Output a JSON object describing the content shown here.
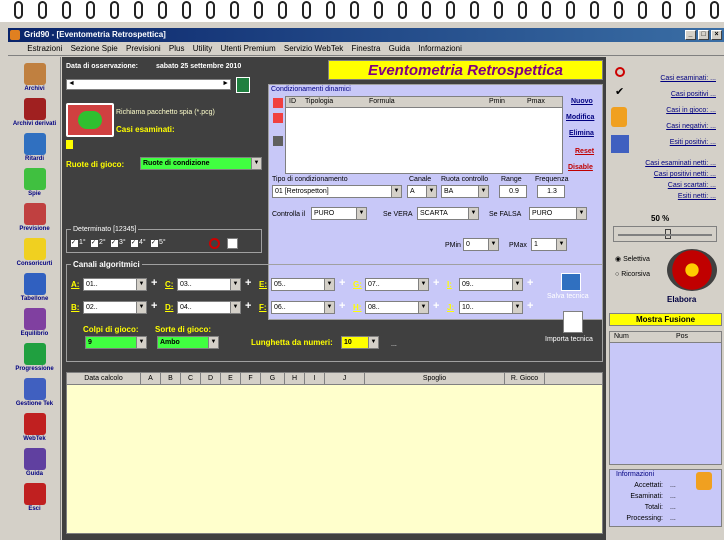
{
  "window": {
    "title": "Grid90 - [Eventometria Retrospettica]",
    "min": "_",
    "restore": "□",
    "close": "×"
  },
  "menu": [
    "Estrazioni",
    "Sezione Spie",
    "Previsioni",
    "Plus",
    "Utility",
    "Utenti Premium",
    "Servizio WebTek",
    "Finestra",
    "Guida",
    "Informazioni"
  ],
  "sidebar": [
    {
      "label": "Archivi",
      "icon": "pencil-icon",
      "color": "#c08040"
    },
    {
      "label": "Archivi derivati",
      "icon": "notebook-icon",
      "color": "#a02020"
    },
    {
      "label": "Ritardi",
      "icon": "clock-icon",
      "color": "#3070c0"
    },
    {
      "label": "Spie",
      "icon": "lens-icon",
      "color": "#40c040"
    },
    {
      "label": "Previsione",
      "icon": "clipboard-icon",
      "color": "#c04040"
    },
    {
      "label": "Consoricurti",
      "icon": "bulb-icon",
      "color": "#f0d020"
    },
    {
      "label": "Tabellone",
      "icon": "table-icon",
      "color": "#3060c0"
    },
    {
      "label": "Equilibrio",
      "icon": "scale-icon",
      "color": "#8040a0"
    },
    {
      "label": "Progressione",
      "icon": "dollar-icon",
      "color": "#20a040"
    },
    {
      "label": "Gestione Tek",
      "icon": "tools-icon",
      "color": "#4060c0"
    },
    {
      "label": "WebTek",
      "icon": "webtek-icon",
      "color": "#c02020"
    },
    {
      "label": "Guida",
      "icon": "book-icon",
      "color": "#6040a0"
    },
    {
      "label": "Esci",
      "icon": "exit-icon",
      "color": "#c02020"
    }
  ],
  "header": {
    "date_label": "Data di osservazione:",
    "date_value": "sabato 25 settembre 2010",
    "page_title": "Eventometria Retrospettica"
  },
  "packet": {
    "load_label": "Richiama pacchetto spia (*.pcg)",
    "cases_label": "Casi esaminati:"
  },
  "wheels": {
    "label": "Ruote di gioco:",
    "value": "Ruote di condizione"
  },
  "determinato": {
    "title": "Determinato [12345]",
    "items": [
      "1°",
      "2°",
      "3°",
      "4°",
      "5°"
    ]
  },
  "conditions": {
    "title": "Condizionamenti dinamici",
    "columns": [
      "ID",
      "Tipologia",
      "Formula",
      "Pmin",
      "Pmax"
    ],
    "buttons": {
      "new": "Nuovo",
      "edit": "Modifica",
      "delete": "Elimina",
      "reset": "Reset",
      "disable": "Disable"
    }
  },
  "cond_form": {
    "type_label": "Tipo di condizionamento",
    "type_value": "01 [Retrospetton]",
    "channel_label": "Canale",
    "channel_value": "A",
    "wheel_label": "Ruota controllo",
    "wheel_value": "BA",
    "range_label": "Range",
    "range_value": "0.9",
    "freq_label": "Frequenza",
    "freq_value": "1.3",
    "check_label": "Controlla il",
    "check_value": "PURO",
    "true_label": "Se VERA",
    "true_value": "SCARTA",
    "false_label": "Se FALSA",
    "false_value": "PURO",
    "pmin_label": "PMin",
    "pmin_value": "0",
    "pmax_label": "PMax",
    "pmax_value": "1"
  },
  "channels": {
    "title": "Canali algoritmici",
    "rows": [
      [
        {
          "l": "A:",
          "v": "01.."
        },
        {
          "l": "C:",
          "v": "03.."
        },
        {
          "l": "E:",
          "v": "05.."
        },
        {
          "l": "G:",
          "v": "07.."
        },
        {
          "l": "I:",
          "v": "09.."
        }
      ],
      [
        {
          "l": "B:",
          "v": "02.."
        },
        {
          "l": "D:",
          "v": "04.."
        },
        {
          "l": "F:",
          "v": "06.."
        },
        {
          "l": "H:",
          "v": "08.."
        },
        {
          "l": "J:",
          "v": "10.."
        }
      ]
    ],
    "save": "Salva tecnica",
    "import": "Importa tecnica",
    "shots_label": "Colpi di gioco:",
    "shots_value": "9",
    "sorts_label": "Sorte di gioco:",
    "sorts_value": "Ambo",
    "length_label": "Lunghetta da numeri:",
    "length_value": "10",
    "ellipsis": "..."
  },
  "table": {
    "columns": [
      "Data calcolo",
      "A",
      "B",
      "C",
      "D",
      "E",
      "F",
      "G",
      "H",
      "I",
      "J",
      "Spoglio",
      "R. Gioco"
    ]
  },
  "right": {
    "links_top": [
      "Casi esaminati: ...",
      "Casi positivi ...",
      "Casi in gioco: ...",
      "Casi negativi: ...",
      "Esiti positivi: ..."
    ],
    "links_bottom": [
      "Casi esaminati netti: ...",
      "Casi positivi netti: ...",
      "Casi scartati: ...",
      "Esiti netti: ..."
    ],
    "percent": "50 %",
    "radio1": "Selettiva",
    "radio2": "Ricorsiva",
    "elabora": "Elabora",
    "fusion": "Mostra Fusione",
    "fusion_cols": [
      "Num",
      "Pos"
    ],
    "info_title": "Informazioni",
    "info": [
      {
        "l": "Accettati:",
        "v": "..."
      },
      {
        "l": "Esaminati:",
        "v": "..."
      },
      {
        "l": "Totali:",
        "v": "..."
      },
      {
        "l": "Processing:",
        "v": "..."
      }
    ]
  }
}
